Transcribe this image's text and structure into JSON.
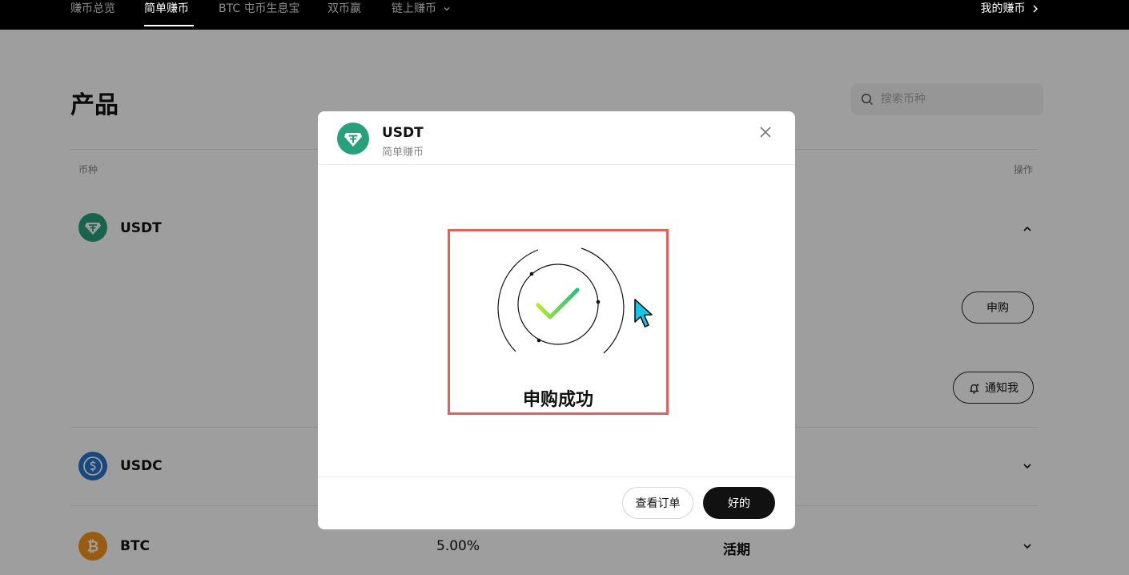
{
  "nav": {
    "items": [
      {
        "label": "赚币总览",
        "active": false
      },
      {
        "label": "简单赚币",
        "active": true
      },
      {
        "label": "BTC 屯币生息宝",
        "active": false
      },
      {
        "label": "双币赢",
        "active": false
      },
      {
        "label": "链上赚币",
        "active": false
      }
    ],
    "right_link": "我的赚币",
    "dropdown_icon": "chevron-down-icon",
    "right_icon": "chevron-right-icon"
  },
  "page": {
    "title": "产品",
    "search_placeholder": "搜索币种",
    "columns": {
      "coin": "币种",
      "action": "操作"
    }
  },
  "coins": [
    {
      "name": "USDT",
      "expanded": true,
      "icon": "usdt-icon",
      "color": "#26a17b"
    },
    {
      "name": "USDC",
      "expanded": false,
      "icon": "usdc-icon",
      "color": "#2775ca"
    },
    {
      "name": "BTC",
      "expanded": false,
      "icon": "btc-icon",
      "color": "#f7931a",
      "apy": "5.00%",
      "term": "活期"
    }
  ],
  "usdt_actions": {
    "subscribe": "申购",
    "notify": "通知我"
  },
  "modal": {
    "coin": "USDT",
    "product": "简单赚币",
    "status": "申购成功",
    "view_orders": "查看订单",
    "ok": "好的"
  },
  "colors": {
    "accent_highlight": "#e0625a",
    "check_start": "#b7e82e",
    "check_end": "#1fc37a"
  }
}
